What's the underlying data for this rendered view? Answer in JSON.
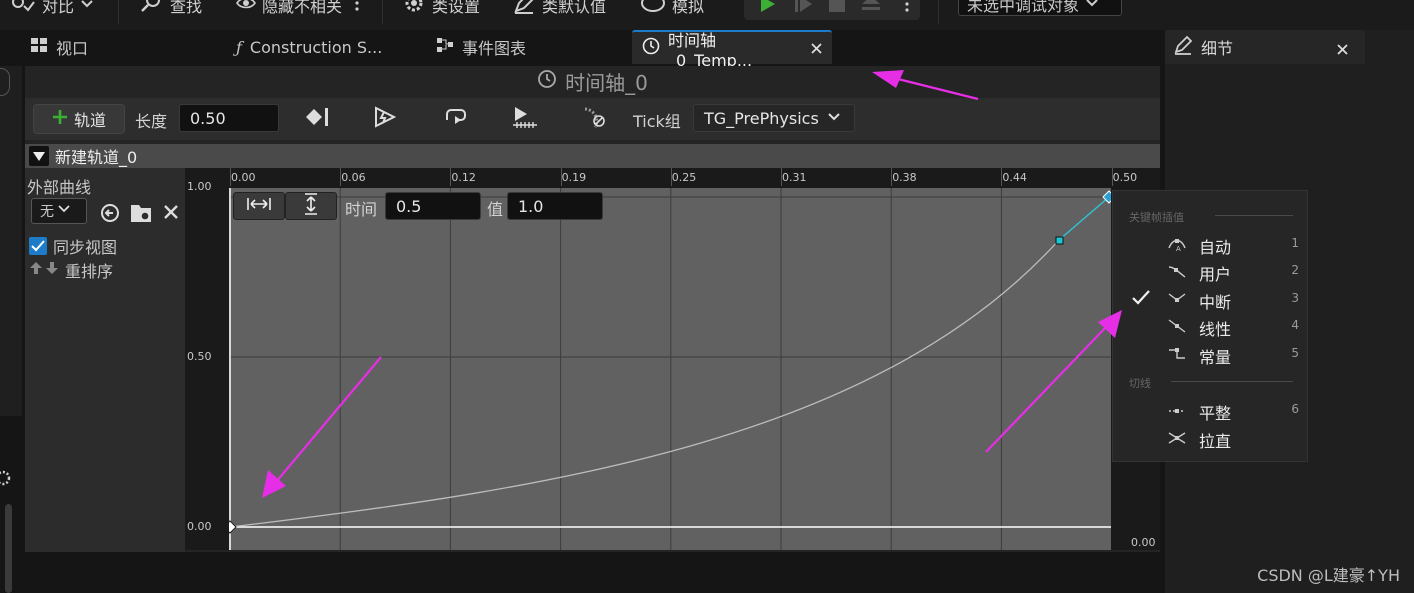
{
  "toolbar": {
    "diff": "对比",
    "find": "查找",
    "hide_unrelated": "隐藏不相关",
    "class_settings": "类设置",
    "class_defaults": "类默认值",
    "simulate": "模拟",
    "debug_target": "未选中调试对象"
  },
  "tabs": [
    {
      "label": "视口"
    },
    {
      "label": "Construction S..."
    },
    {
      "label": "事件图表"
    },
    {
      "label": "时间轴_0_Temp..."
    }
  ],
  "details_panel": {
    "title": "细节"
  },
  "timeline": {
    "title": "时间轴_0",
    "add_track": "轨道",
    "length_label": "长度",
    "length_value": "0.50",
    "tick_group_label": "Tick组",
    "tick_group_value": "TG_PrePhysics",
    "track_name": "新建轨道_0",
    "external_curve_label": "外部曲线",
    "external_curve_value": "无",
    "sync_view_label": "同步视图",
    "sync_view_checked": true,
    "reorder_label": "重排序",
    "time_label": "时间",
    "time_value": "0.5",
    "value_label": "值",
    "value_value": "1.0",
    "x_ticks": [
      "0.00",
      "0.06",
      "0.12",
      "0.19",
      "0.25",
      "0.31",
      "0.38",
      "0.44",
      "0.50"
    ],
    "y_ticks": [
      "1.00",
      "0.50",
      "0.00"
    ],
    "y_right_label": "0.00"
  },
  "menu": {
    "section_interp": "关键帧插值",
    "section_tangent": "切线",
    "items": [
      {
        "label": "自动",
        "key": "1",
        "checked": false
      },
      {
        "label": "用户",
        "key": "2",
        "checked": false
      },
      {
        "label": "中断",
        "key": "3",
        "checked": true
      },
      {
        "label": "线性",
        "key": "4",
        "checked": false
      },
      {
        "label": "常量",
        "key": "5",
        "checked": false
      }
    ],
    "tangent_items": [
      {
        "label": "平整",
        "key": "6"
      },
      {
        "label": "拉直",
        "key": ""
      }
    ]
  },
  "watermark": "CSDN @L建豪↑YH",
  "colors": {
    "accent": "#1d7cc9",
    "annotation_arrow": "#e62ee6",
    "curve": "#bcbcbc",
    "key_selected": "#2a9fd6",
    "play_green": "#3cb034"
  }
}
